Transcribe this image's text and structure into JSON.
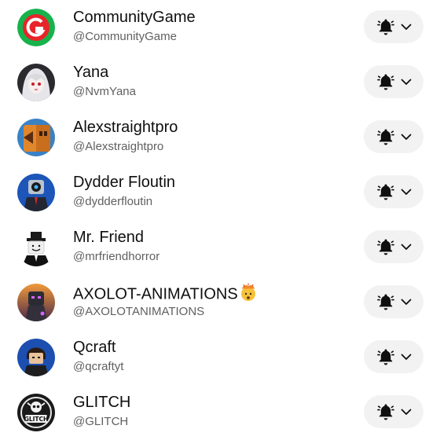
{
  "subscriptions": [
    {
      "name": "CommunityGame",
      "handle": "@CommunityGame",
      "avatar": "communitygame-avatar"
    },
    {
      "name": "Yana",
      "handle": "@NvmYana",
      "avatar": "yana-avatar"
    },
    {
      "name": "Alexstraightpro",
      "handle": "@Alexstraightpro",
      "avatar": "alexstraightpro-avatar"
    },
    {
      "name": "Dydder Floutin",
      "handle": "@dydderfloutin",
      "avatar": "dydder-avatar"
    },
    {
      "name": "Mr. Friend",
      "handle": "@mrfriendhorror",
      "avatar": "mrfriend-avatar"
    },
    {
      "name": "AXOLOT-ANIMATIONS",
      "handle": "@AXOLOTANIMATIONS",
      "avatar": "axolot-avatar",
      "emoji": "exploding-head-emoji"
    },
    {
      "name": "Qcraft",
      "handle": "@qcraftyt",
      "avatar": "qcraft-avatar"
    },
    {
      "name": "GLITCH",
      "handle": "@GLITCH",
      "avatar": "glitch-avatar",
      "avatar_text": "GLITCH"
    }
  ],
  "notification_button": {
    "icon": "bell-icon",
    "dropdown_icon": "chevron-down-icon"
  },
  "colors": {
    "text": "#0f0f0f",
    "secondary_text": "#606060",
    "button_bg": "#f2f2f2"
  }
}
